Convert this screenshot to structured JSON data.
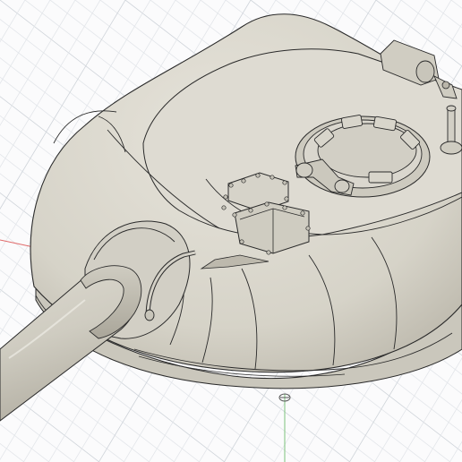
{
  "colors": {
    "background": "#fbfbfc",
    "grid_minor": "#e3e6ea",
    "grid_major": "#cfd4da",
    "axis_red": "#e06a6a",
    "axis_green": "#7cc37c",
    "body_fill": "#d9d6cc",
    "body_light": "#e4e1d8",
    "body_shadow": "#b8b4a8",
    "edge": "#2a2a2a"
  },
  "scene": {
    "model": "turret-model",
    "components": [
      "grid-floor",
      "turret-body",
      "gun-barrel",
      "mantlet",
      "hatch-ring",
      "vision-block",
      "periscope-box",
      "antenna-mount",
      "grab-handle"
    ]
  }
}
